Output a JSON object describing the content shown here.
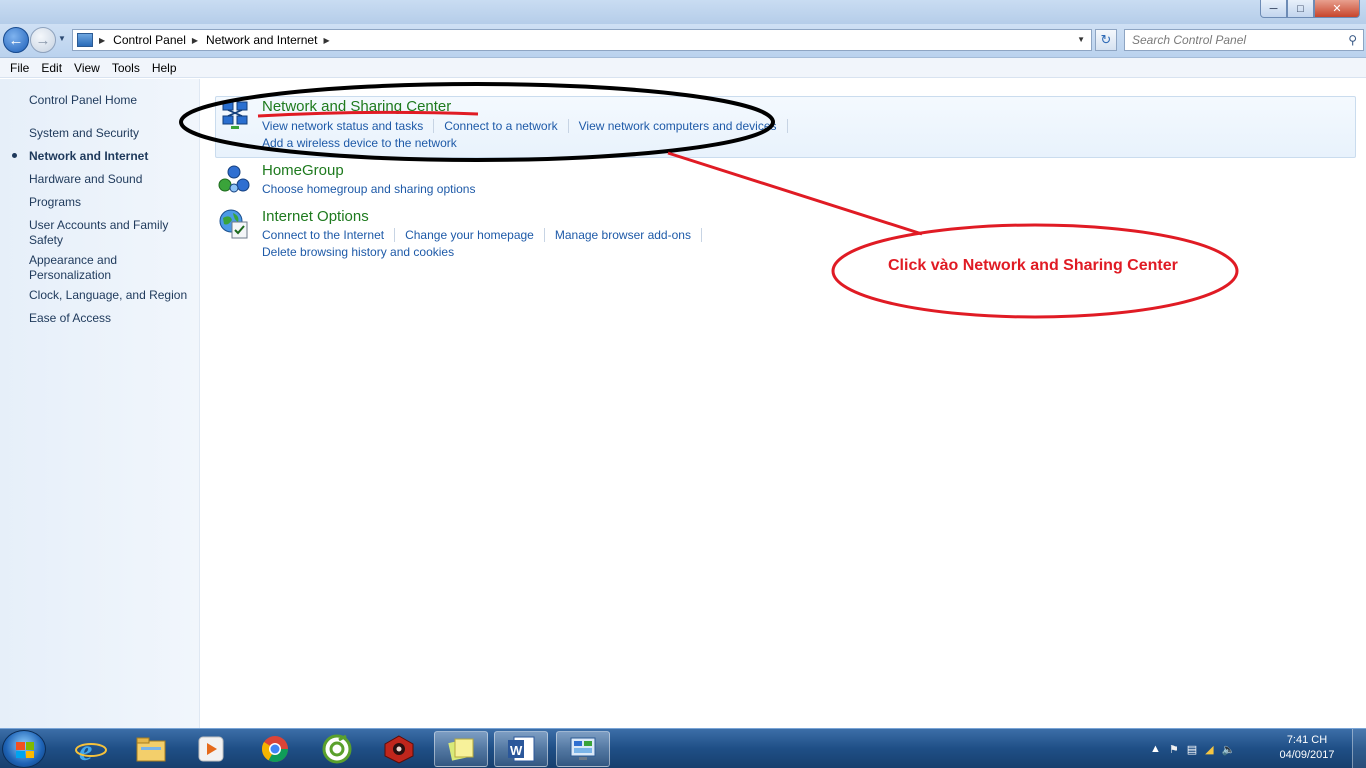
{
  "address": {
    "crumbs": [
      "Control Panel",
      "Network and Internet"
    ]
  },
  "search": {
    "placeholder": "Search Control Panel"
  },
  "menu": [
    "File",
    "Edit",
    "View",
    "Tools",
    "Help"
  ],
  "sidebar": {
    "items": [
      {
        "label": "Control Panel Home",
        "active": false
      },
      {
        "label": "System and Security",
        "active": false
      },
      {
        "label": "Network and Internet",
        "active": true
      },
      {
        "label": "Hardware and Sound",
        "active": false
      },
      {
        "label": "Programs",
        "active": false
      },
      {
        "label": "User Accounts and Family Safety",
        "active": false
      },
      {
        "label": "Appearance and Personalization",
        "active": false
      },
      {
        "label": "Clock, Language, and Region",
        "active": false
      },
      {
        "label": "Ease of Access",
        "active": false
      }
    ]
  },
  "categories": [
    {
      "title": "Network and Sharing Center",
      "links": [
        "View network status and tasks",
        "Connect to a network",
        "View network computers and devices"
      ],
      "link2": "Add a wireless device to the network"
    },
    {
      "title": "HomeGroup",
      "links": [],
      "link2": "Choose homegroup and sharing options"
    },
    {
      "title": "Internet Options",
      "links": [
        "Connect to the Internet",
        "Change your homepage",
        "Manage browser add-ons"
      ],
      "link2": "Delete browsing history and cookies"
    }
  ],
  "annotation": {
    "text": "Click vào Network and Sharing Center",
    "color": "#e01b24"
  },
  "taskbar": {
    "apps": [
      "internet-explorer",
      "windows-explorer",
      "media-player",
      "chrome",
      "coccoc",
      "red-app",
      "sticky-notes",
      "word",
      "control-panel"
    ],
    "active_app": "control-panel",
    "time": "7:41 CH",
    "date": "04/09/2017"
  },
  "colors": {
    "accent": "#1e5aa8",
    "category": "#1e7a1e",
    "taskbar": "#1f4f86"
  }
}
